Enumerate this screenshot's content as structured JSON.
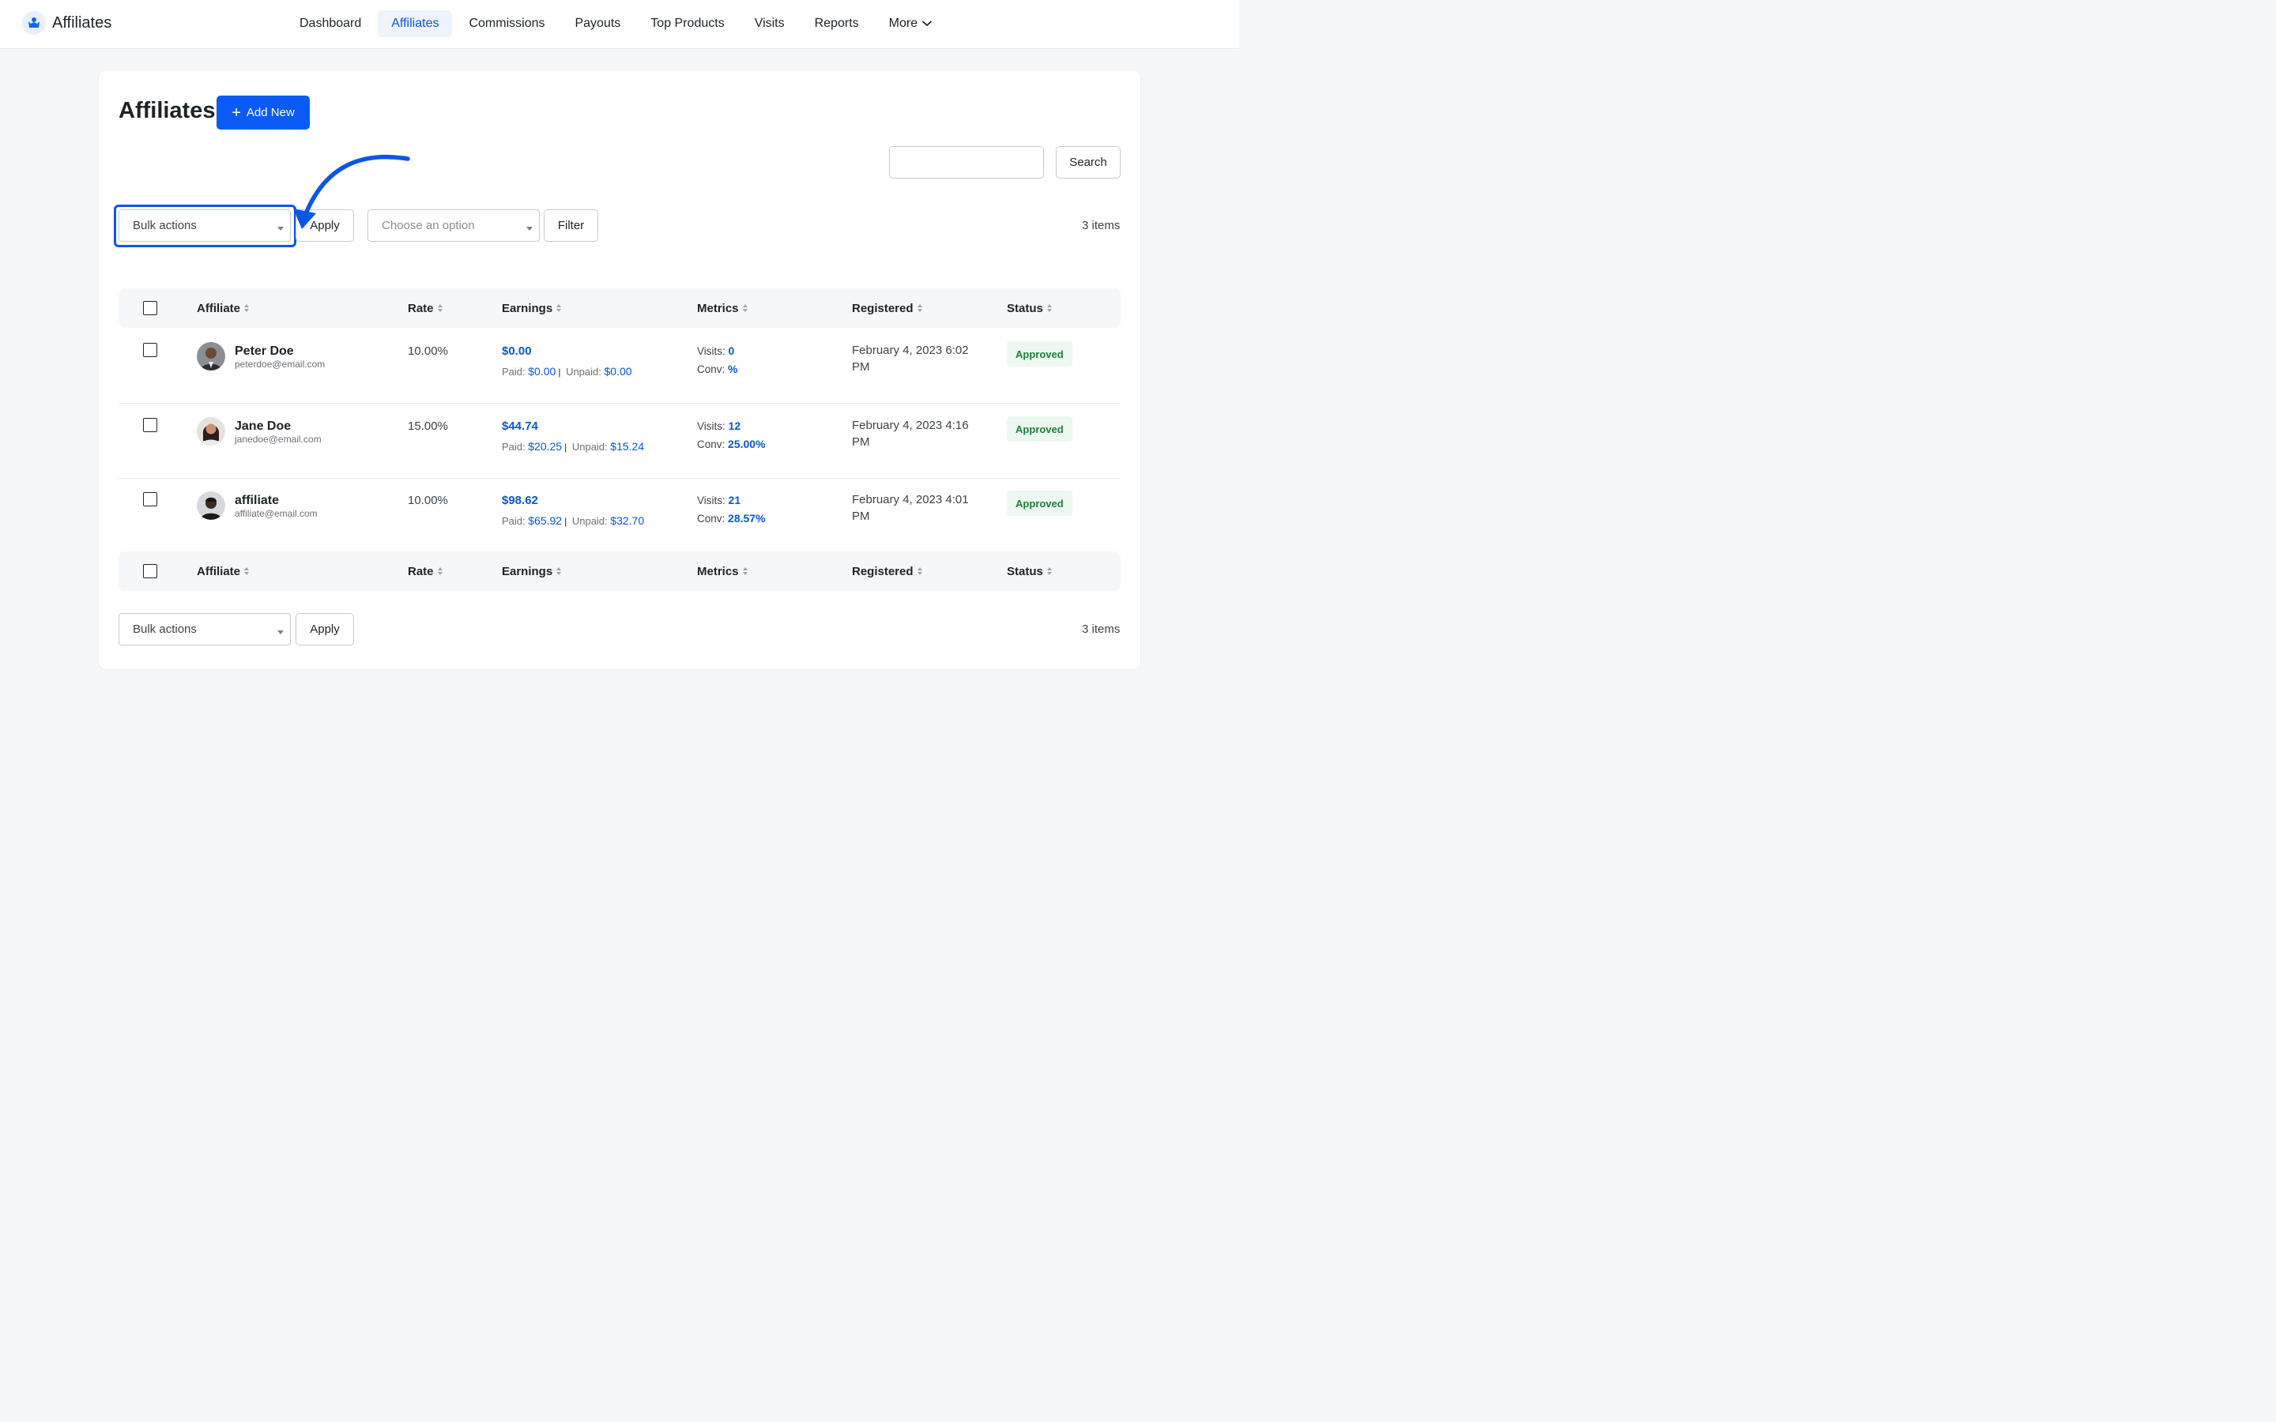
{
  "brand": {
    "name": "Affiliates"
  },
  "nav": {
    "items": [
      "Dashboard",
      "Affiliates",
      "Commissions",
      "Payouts",
      "Top Products",
      "Visits",
      "Reports",
      "More"
    ]
  },
  "page": {
    "title": "Affiliates",
    "add_new_label": "Add New"
  },
  "search": {
    "value": "",
    "button_label": "Search"
  },
  "toolbar_top": {
    "bulk_actions": "Bulk actions",
    "apply_label": "Apply",
    "filter_select": "Choose an option",
    "filter_label": "Filter",
    "items_count": "3 items"
  },
  "table": {
    "columns": [
      "Affiliate",
      "Rate",
      "Earnings",
      "Metrics",
      "Registered",
      "Status"
    ],
    "rows": [
      {
        "name": "Peter Doe",
        "email": "peterdoe@email.com",
        "rate": "10.00%",
        "earnings": "$0.00",
        "paid_label": "Paid:",
        "paid": "$0.00",
        "unpaid_label": "Unpaid:",
        "unpaid": "$0.00",
        "visits_label": "Visits:",
        "visits": "0",
        "conv_label": "Conv:",
        "conv": "%",
        "registered": "February 4, 2023 6:02 PM",
        "status": "Approved"
      },
      {
        "name": "Jane Doe",
        "email": "janedoe@email.com",
        "rate": "15.00%",
        "earnings": "$44.74",
        "paid_label": "Paid:",
        "paid": "$20.25",
        "unpaid_label": "Unpaid:",
        "unpaid": "$15.24",
        "visits_label": "Visits:",
        "visits": "12",
        "conv_label": "Conv:",
        "conv": "25.00%",
        "registered": "February 4, 2023 4:16 PM",
        "status": "Approved"
      },
      {
        "name": "affiliate",
        "email": "affiliate@email.com",
        "rate": "10.00%",
        "earnings": "$98.62",
        "paid_label": "Paid:",
        "paid": "$65.92",
        "unpaid_label": "Unpaid:",
        "unpaid": "$32.70",
        "visits_label": "Visits:",
        "visits": "21",
        "conv_label": "Conv:",
        "conv": "28.57%",
        "registered": "February 4, 2023 4:01 PM",
        "status": "Approved"
      }
    ]
  },
  "toolbar_bottom": {
    "bulk_actions": "Bulk actions",
    "apply_label": "Apply",
    "items_count": "3 items"
  },
  "colors": {
    "accent": "#0a5bf5",
    "link": "#0a56d6",
    "status_bg": "#edf8f0",
    "status_text": "#1b7f3a"
  },
  "icons": {
    "brand": "affiliate-logo-icon",
    "more": "chevron-down-icon",
    "add": "plus-icon",
    "annotation": "curved-arrow-icon"
  }
}
